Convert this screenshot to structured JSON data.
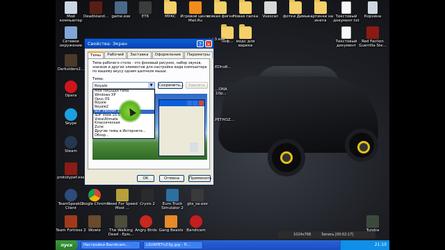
{
  "desktop": {
    "icons_top_row": [
      {
        "label": "Мой компьютер",
        "icon": "computer-icon"
      },
      {
        "label": "DeadIsland...",
        "icon": "game-icon"
      },
      {
        "label": "game.exe",
        "icon": "game-icon"
      },
      {
        "label": "ЕТ6",
        "icon": "game-icon"
      },
      {
        "label": "МУАС",
        "icon": "folder-icon"
      },
      {
        "label": "Игровой центр Mail.Ru",
        "icon": "game-center-icon"
      },
      {
        "label": "всякая фигня",
        "icon": "folder-icon"
      },
      {
        "label": "Новая папка",
        "icon": "folder-icon"
      },
      {
        "label": "Vuescan",
        "icon": "scanner-icon"
      },
      {
        "label": "фотки Димы",
        "icon": "folder-icon"
      },
      {
        "label": "картинки на инета",
        "icon": "folder-icon"
      },
      {
        "label": "Текстовый документ.txt",
        "icon": "text-document-icon"
      },
      {
        "label": "Корзина",
        "icon": "recycle-bin-icon"
      }
    ],
    "icons_second_row": [
      {
        "label": "Сетевое окружение",
        "icon": "network-icon"
      },
      {
        "label": "неф...",
        "icon": "folder-icon"
      },
      {
        "label": "модс для варика",
        "icon": "folder-icon"
      },
      {
        "label": "Текстовый документ",
        "icon": "text-document-icon"
      },
      {
        "label": "Red Faction Guerrilla Ste...",
        "icon": "game-icon"
      }
    ],
    "icons_left_column": [
      {
        "label": "Darksiders2...",
        "icon": "game-icon"
      },
      {
        "label": "Opera",
        "icon": "opera-icon"
      },
      {
        "label": "Skype",
        "icon": "skype-icon"
      },
      {
        "label": "Steam",
        "icon": "steam-icon"
      },
      {
        "label": "prototypef.exe",
        "icon": "game-icon"
      },
      {
        "label": "TeamSpeak 3 Client",
        "icon": "teamspeak-icon"
      },
      {
        "label": "Team Fortress 2",
        "icon": "game-icon"
      }
    ],
    "icons_bottom_row": [
      {
        "label": "Google Chrome",
        "icon": "chrome-icon"
      },
      {
        "label": "Need For Speed Most ...",
        "icon": "game-icon"
      },
      {
        "label": "Crysis 2",
        "icon": "game-icon"
      },
      {
        "label": "Euro Truck Simulator 2",
        "icon": "game-icon"
      },
      {
        "label": "gta_sa.exe",
        "icon": "game-icon"
      },
      {
        "label": "Wowie",
        "icon": "game-icon"
      },
      {
        "label": "The Walking Dead - Epis...",
        "icon": "game-icon"
      },
      {
        "label": "Angry Birds",
        "icon": "game-icon"
      },
      {
        "label": "Gang Beasts",
        "icon": "game-icon"
      },
      {
        "label": "Bandicam",
        "icon": "bandicam-icon"
      }
    ],
    "icons_misc": [
      {
        "label": "lek3.exe",
        "icon": "game-icon"
      },
      {
        "label": "...EDhoR...",
        "icon": "game-icon"
      },
      {
        "label": "...ONA 10p...",
        "icon": "game-icon"
      },
      {
        "label": "...PETHOZ...",
        "icon": "game-icon"
      },
      {
        "label": "Tundra",
        "icon": "game-icon"
      }
    ]
  },
  "dialog": {
    "title": "Свойства: Экран",
    "tabs": [
      "Темы",
      "Рабочий стол",
      "Заставка",
      "Оформление",
      "Параметры"
    ],
    "active_tab": 0,
    "description": "Тема рабочего стола - это фоновый рисунок, набор звуков, значков и других элементов для настройки вида компьютера по вашему вкусу одним щелчком мыши.",
    "theme_label": "Тема:",
    "theme_value": "Royale",
    "save_label": "Сохранить...",
    "delete_label": "Удалить",
    "theme_options": [
      "Моя текущая тема",
      "Windows XP",
      "Opus OS",
      "Royale",
      "Royale2",
      "SDF Panther 3.0",
      "SDF Vista 10.5 HD",
      "VistaUltimate",
      "Классическая",
      "Zune",
      "Другие темы в Интернете...",
      "Обзор..."
    ],
    "selected_option": 5,
    "ok_label": "OK",
    "cancel_label": "Отмена",
    "apply_label": "Применить"
  },
  "taskbar": {
    "start_label": "пуск",
    "tasks": [
      "Настройки Bandicam...",
      "LSURPETnZ3g.jpg - П..."
    ],
    "clock": "21:10"
  },
  "recording": {
    "resolution": "1024x768",
    "status": "Запись [00:02:17]"
  },
  "colors": {
    "titlebar": "#0a5fd8",
    "taskbar": "#245dd7",
    "start_button": "#3c9a3c",
    "selected_item": "#316ac5",
    "wheel_accent": "#e3c318"
  }
}
